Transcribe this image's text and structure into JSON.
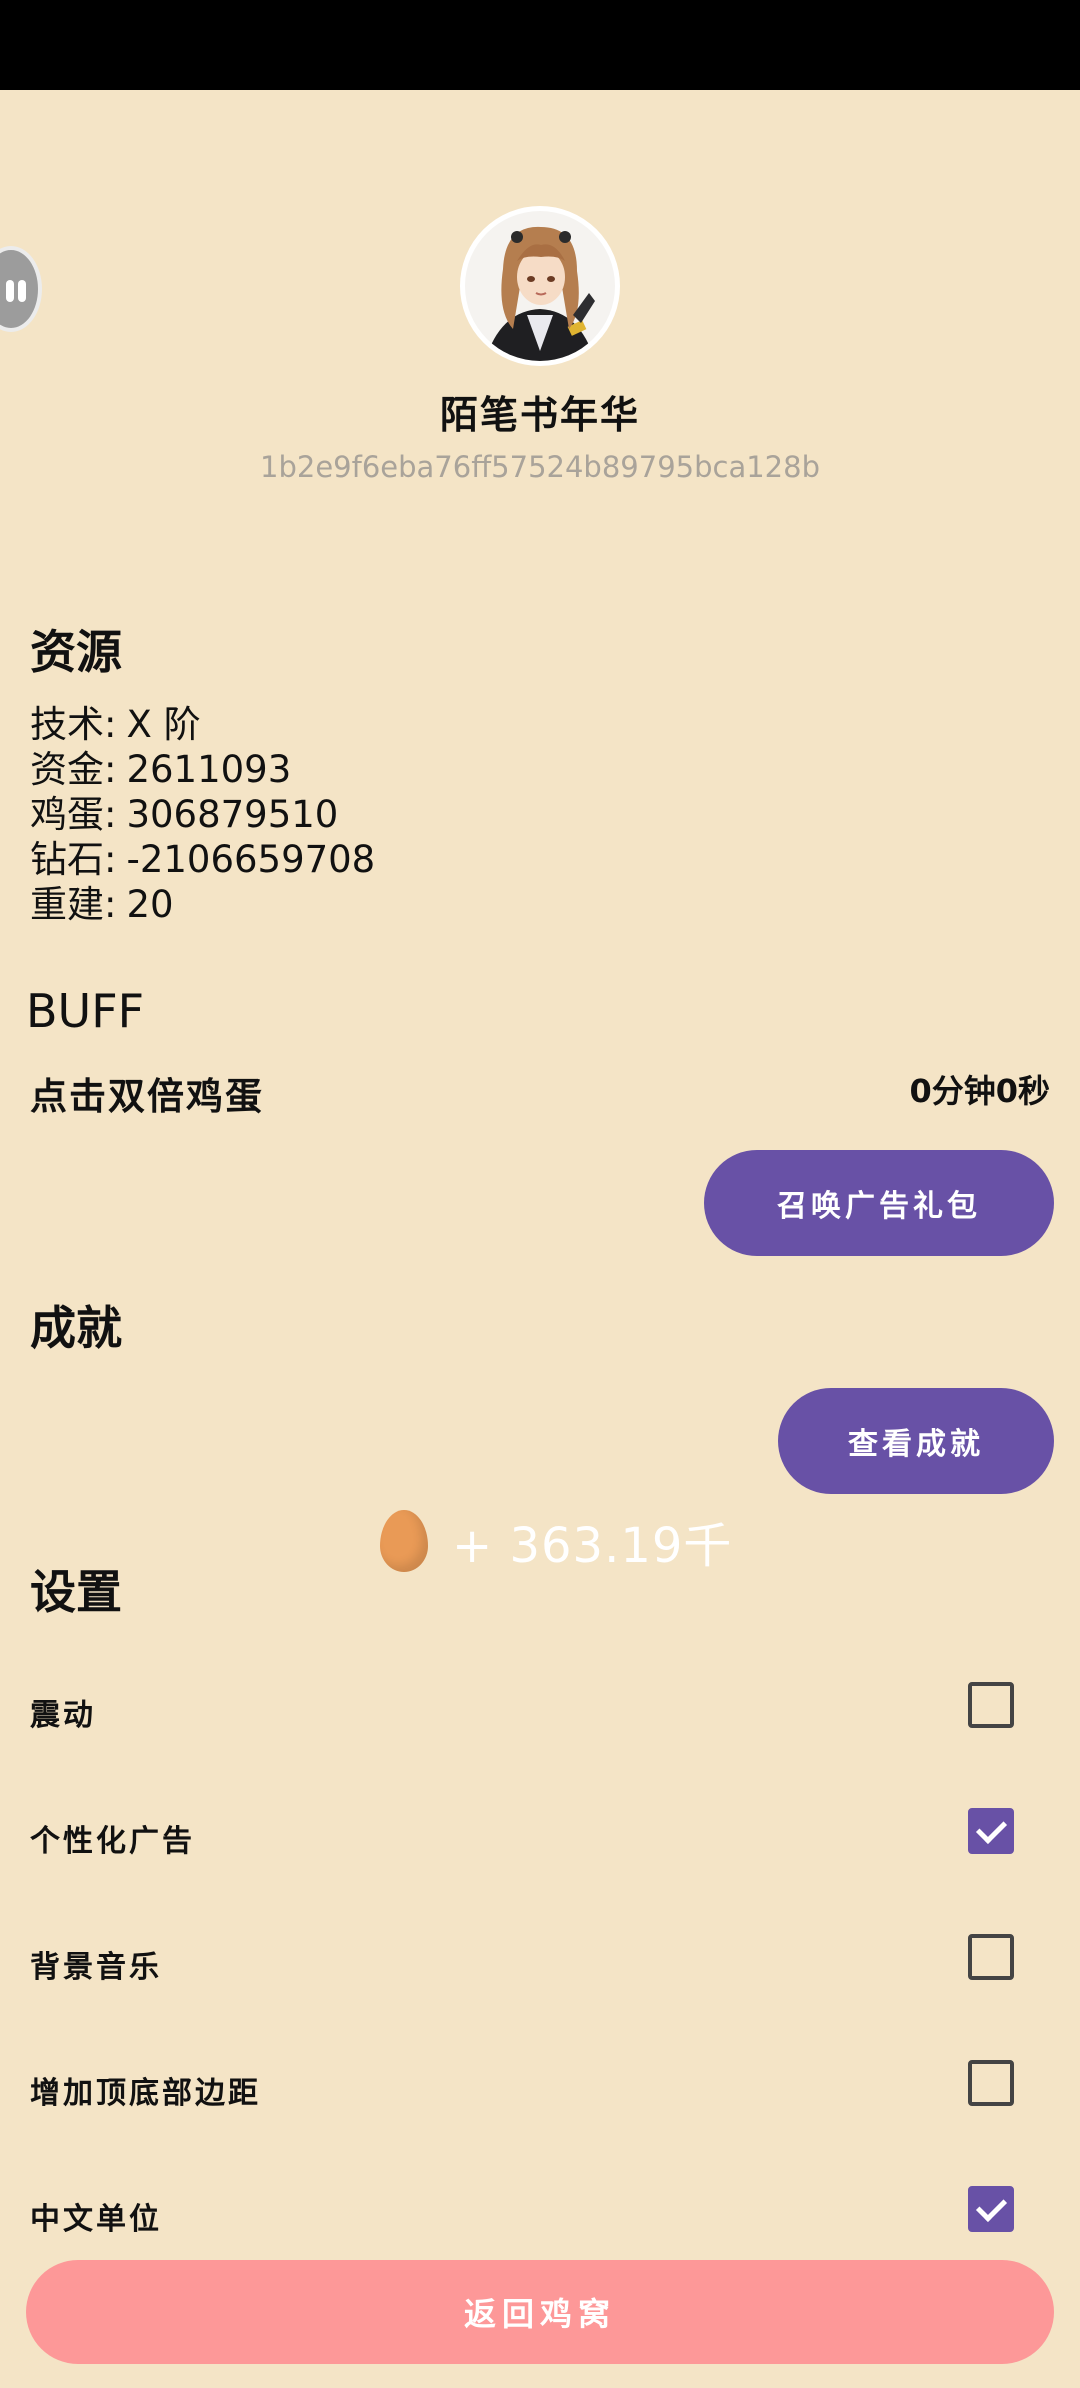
{
  "profile": {
    "nickname": "陌笔书年华",
    "user_id": "1b2e9f6eba76ff57524b89795bca128b"
  },
  "resources": {
    "title": "资源",
    "items": [
      {
        "label": "技术:",
        "value": "X 阶"
      },
      {
        "label": "资金:",
        "value": "2611093"
      },
      {
        "label": "鸡蛋:",
        "value": "306879510"
      },
      {
        "label": "钻石:",
        "value": "-2106659708"
      },
      {
        "label": "重建:",
        "value": "20"
      }
    ]
  },
  "buff": {
    "title": "BUFF",
    "name": "点击双倍鸡蛋",
    "time": "0分钟0秒",
    "ad_button": "召唤广告礼包"
  },
  "achievements": {
    "title": "成就",
    "button": "查看成就"
  },
  "floating_gain": {
    "icon": "egg-icon",
    "text": "+ 363.19千"
  },
  "settings": {
    "title": "设置",
    "items": [
      {
        "label": "震动",
        "checked": false
      },
      {
        "label": "个性化广告",
        "checked": true
      },
      {
        "label": "背景音乐",
        "checked": false
      },
      {
        "label": "增加顶底部边距",
        "checked": false
      },
      {
        "label": "中文单位",
        "checked": true
      }
    ]
  },
  "return_button": "返回鸡窝",
  "colors": {
    "background": "#f4e4c6",
    "accent": "#6851a6",
    "return_button": "#fd9898"
  }
}
